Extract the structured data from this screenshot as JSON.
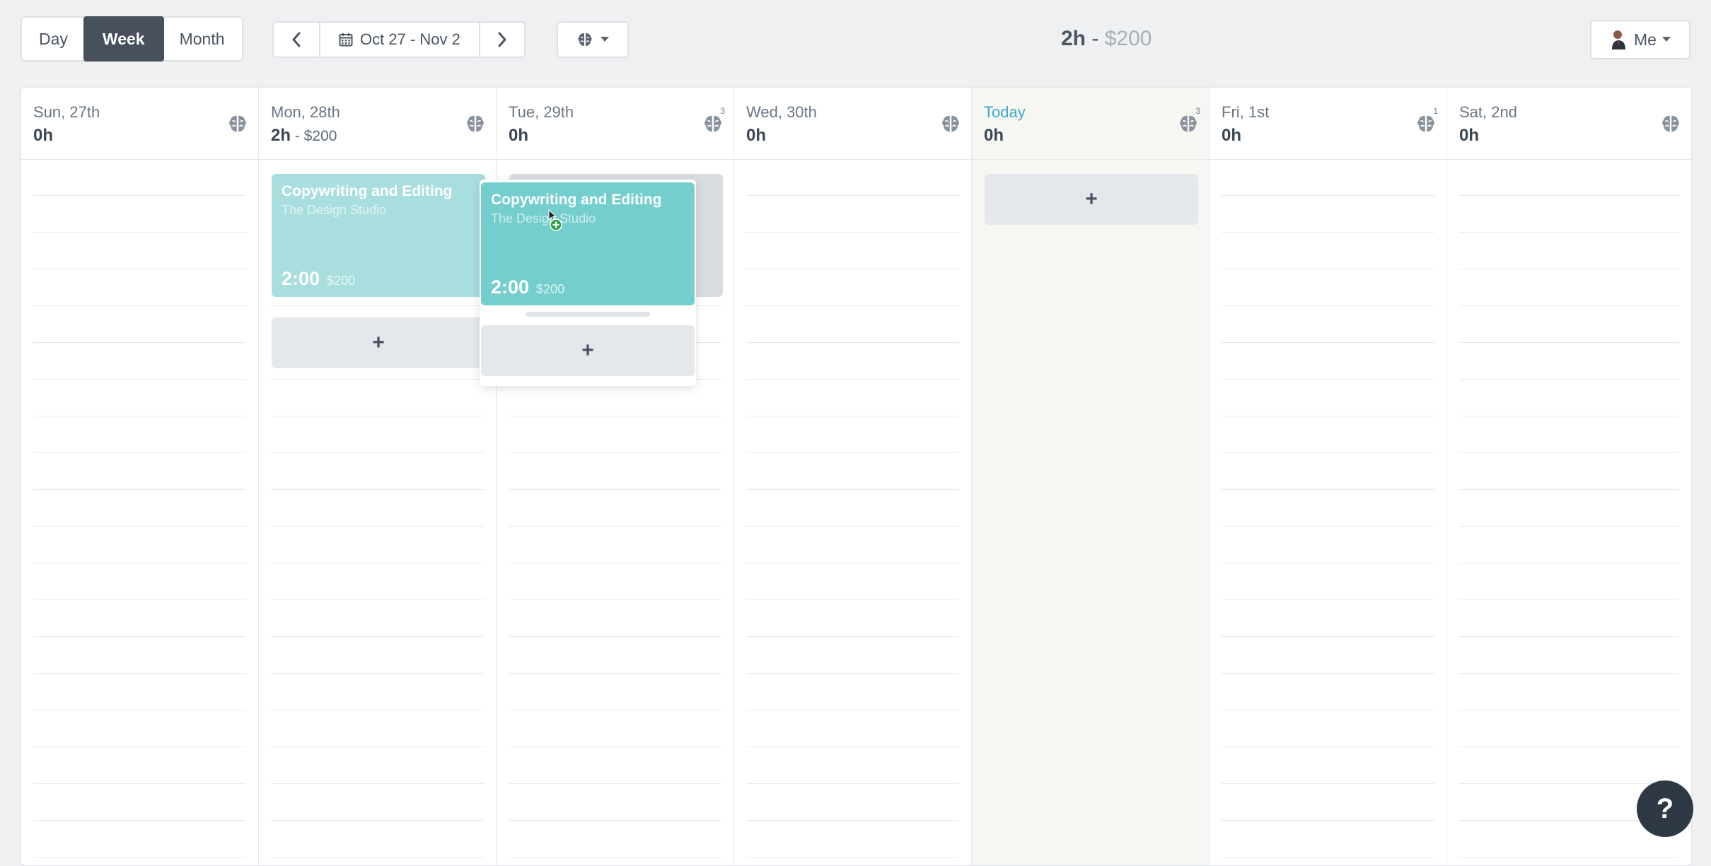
{
  "toolbar": {
    "views": [
      "Day",
      "Week",
      "Month"
    ],
    "active_view": "Week",
    "date_range": "Oct 27 - Nov 2",
    "summary_hours": "2h",
    "summary_sep": "-",
    "summary_money": "$200",
    "user_label": "Me"
  },
  "days": [
    {
      "name": "Sun, 27th",
      "hours": "0h",
      "extra": ""
    },
    {
      "name": "Mon, 28th",
      "hours": "2h",
      "extra": " - $200"
    },
    {
      "name": "Tue, 29th",
      "hours": "0h",
      "extra": "",
      "badge": "3"
    },
    {
      "name": "Wed, 30th",
      "hours": "0h",
      "extra": ""
    },
    {
      "name": "Today",
      "hours": "0h",
      "extra": "",
      "badge": "3"
    },
    {
      "name": "Fri, 1st",
      "hours": "0h",
      "extra": "",
      "badge": "1"
    },
    {
      "name": "Sat, 2nd",
      "hours": "0h",
      "extra": ""
    }
  ],
  "entries": [
    {
      "title": "Copywriting and Editing",
      "client": "The Design Studio",
      "time": "2:00",
      "amount": "$200"
    },
    {
      "title": "Copywriting and Editing",
      "client": "The Design Studio",
      "time": "2:00",
      "amount": "$200"
    }
  ],
  "add_symbol": "+",
  "help_symbol": "?",
  "colors": {
    "entry_faded": "#a8dede",
    "entry_drag": "#74cece",
    "active_btn": "#47505b",
    "today_label": "#3ea6cf"
  },
  "icons": [
    "chevron-left-icon",
    "calendar-icon",
    "chevron-right-icon",
    "brain-icon",
    "caret-down-icon",
    "avatar-icon"
  ]
}
